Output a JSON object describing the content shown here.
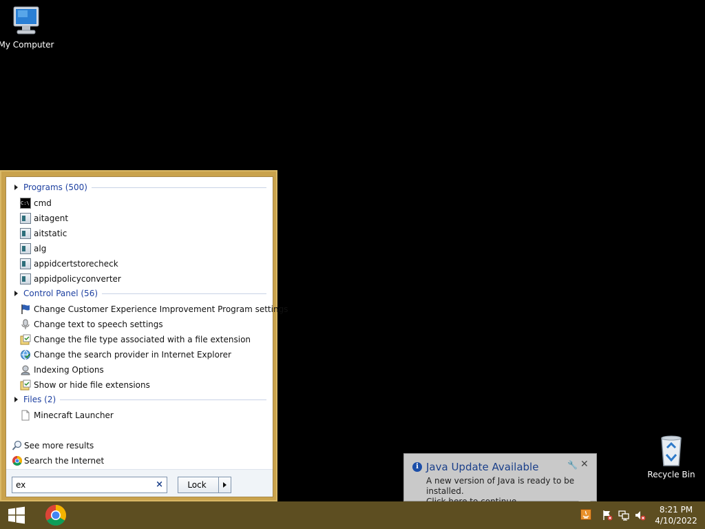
{
  "desktop": {
    "icons": [
      {
        "label": "My Computer"
      },
      {
        "label": "Recycle Bin"
      }
    ]
  },
  "start_menu": {
    "sections": {
      "programs": {
        "title": "Programs (500)",
        "items": [
          "cmd",
          "aitagent",
          "aitstatic",
          "alg",
          "appidcertstorecheck",
          "appidpolicyconverter"
        ]
      },
      "control_panel": {
        "title": "Control Panel (56)",
        "items": [
          "Change Customer Experience Improvement Program settings",
          "Change text to speech settings",
          "Change the file type associated with a file extension",
          "Change the search provider in Internet Explorer",
          "Indexing Options",
          "Show or hide file extensions"
        ]
      },
      "files": {
        "title": "Files (2)",
        "items": [
          "Minecraft Launcher"
        ]
      }
    },
    "see_more": "See more results",
    "search_internet": "Search the Internet",
    "search": {
      "value": "ex"
    },
    "lock_label": "Lock",
    "cmd_icon_text": "C:\\"
  },
  "notification": {
    "title": "Java Update Available",
    "line1": "A new version of Java is ready to be installed.",
    "line2": "Click here to continue."
  },
  "taskbar": {
    "time": "8:21 PM",
    "date": "4/10/2022"
  },
  "colors": {
    "taskbar": "#5d4e21",
    "start_menu_border": "#c9a24c",
    "link_blue": "#1c3fa0"
  }
}
